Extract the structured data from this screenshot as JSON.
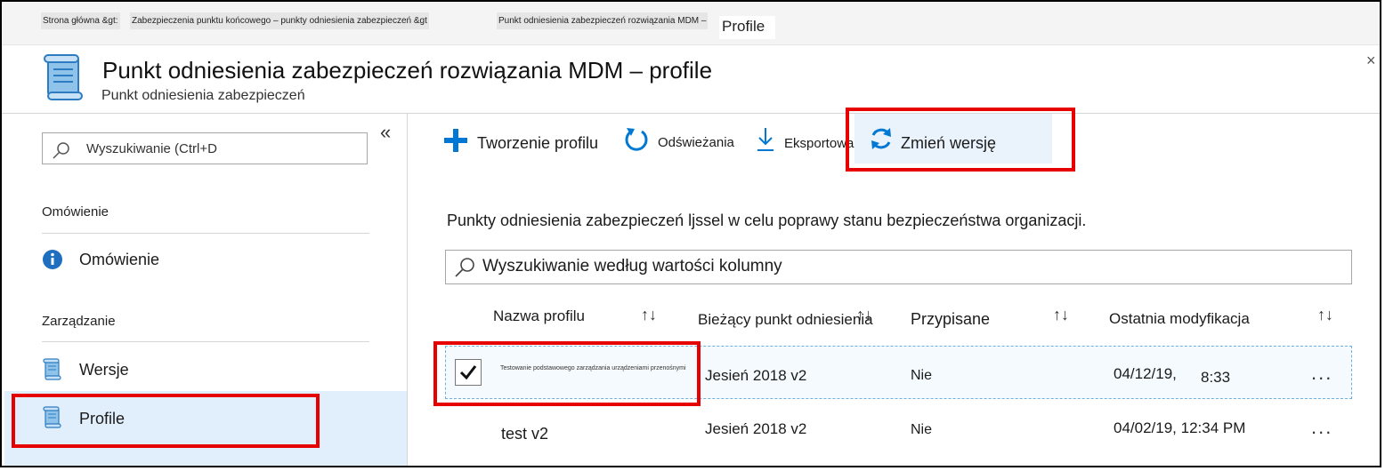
{
  "breadcrumb": {
    "items": [
      "Strona główna &gt:",
      "Zabezpieczenia punktu końcowego – punkty odniesienia zabezpieczeń &gt",
      "Punkt odniesienia zabezpieczeń rozwiązania MDM –",
      "Profile"
    ]
  },
  "header": {
    "title": "Punkt odniesienia zabezpieczeń rozwiązania MDM – profile",
    "subtitle": "Punkt odniesienia zabezpieczeń",
    "icon": "scroll-icon",
    "close_glyph": "×"
  },
  "sidebar": {
    "search_placeholder": "Wyszukiwanie (Ctrl+D",
    "collapse_glyph": "«",
    "sections": [
      {
        "title": "Omówienie",
        "items": [
          {
            "label": "Omówienie",
            "icon": "info-icon"
          }
        ]
      },
      {
        "title": "Zarządzanie",
        "items": [
          {
            "label": "Wersje",
            "icon": "scroll-icon"
          },
          {
            "label": "Profile",
            "icon": "scroll-icon",
            "active": true
          }
        ]
      }
    ]
  },
  "toolbar": {
    "create": "Tworzenie profilu",
    "refresh": "Odświeżania",
    "export": "Eksportowanie",
    "change_version": "Zmień wersję"
  },
  "main": {
    "description": "Punkty odniesienia zabezpieczeń ljssel w celu poprawy stanu bezpieczeństwa organizacji.",
    "column_search_placeholder": "Wyszukiwanie według wartości kolumny",
    "columns": [
      "Nazwa profilu",
      "Bieżący punkt odniesienia",
      "Przypisane",
      "Ostatnia modyfikacja"
    ],
    "sort_glyph": "↑↓",
    "rows": [
      {
        "name": "Testowanie podstawowego zarządzania urządzeniami przenośnymi",
        "baseline": "Jesień 2018 v2",
        "assigned": "Nie",
        "modified_date": "04/12/19,",
        "modified_time": "8:33",
        "selected": true
      },
      {
        "name": "test v2",
        "baseline": "Jesień 2018 v2",
        "assigned": "Nie",
        "modified_date": "04/02/19, 12:34 PM",
        "modified_time": "",
        "selected": false
      }
    ],
    "more_glyph": "..."
  },
  "colors": {
    "accent": "#0078d4",
    "highlight_red": "#e60000",
    "selected_bg": "#e1eefb"
  }
}
